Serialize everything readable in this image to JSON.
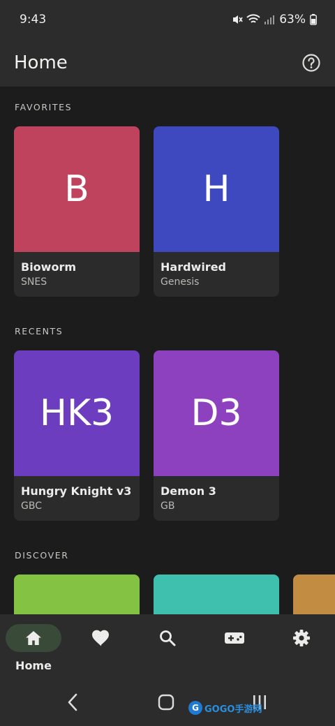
{
  "status_bar": {
    "time": "9:43",
    "battery": "63%"
  },
  "app_bar": {
    "title": "Home"
  },
  "sections": {
    "favorites": {
      "label": "FAVORITES",
      "items": [
        {
          "initials": "B",
          "title": "Bioworm",
          "platform": "SNES",
          "color": "#c0435e"
        },
        {
          "initials": "H",
          "title": "Hardwired",
          "platform": "Genesis",
          "color": "#3e48bf"
        }
      ]
    },
    "recents": {
      "label": "RECENTS",
      "items": [
        {
          "initials": "HK3",
          "title": "Hungry Knight v3",
          "platform": "GBC",
          "color": "#6c3ebf"
        },
        {
          "initials": "D3",
          "title": "Demon 3",
          "platform": "GB",
          "color": "#8e41bf"
        }
      ]
    },
    "discover": {
      "label": "DISCOVER",
      "colors": [
        "#84c243",
        "#3fbfad",
        "#c28c43"
      ]
    }
  },
  "bottom_nav": {
    "items": [
      {
        "icon": "home-icon",
        "label": "Home",
        "active": true
      },
      {
        "icon": "heart-icon"
      },
      {
        "icon": "search-icon"
      },
      {
        "icon": "gamepad-icon"
      },
      {
        "icon": "settings-icon"
      }
    ]
  },
  "watermark": {
    "text": "GOGO手游网"
  }
}
